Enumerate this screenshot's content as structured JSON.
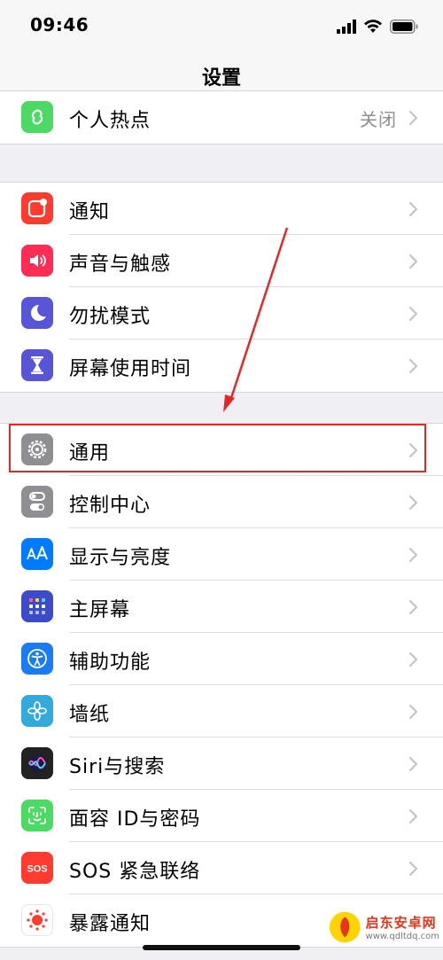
{
  "status_bar": {
    "time": "09:46"
  },
  "header": {
    "title": "设置"
  },
  "groups": [
    {
      "rows": [
        {
          "id": "hotspot",
          "label": "个人热点",
          "value": "关闭",
          "icon": "personal-hotspot-icon",
          "color": "#4cd964"
        }
      ]
    },
    {
      "rows": [
        {
          "id": "notifications",
          "label": "通知",
          "icon": "notifications-icon",
          "color": "#ff3b30"
        },
        {
          "id": "sounds",
          "label": "声音与触感",
          "icon": "speaker-icon",
          "color": "#ff2d55"
        },
        {
          "id": "dnd",
          "label": "勿扰模式",
          "icon": "moon-icon",
          "color": "#5856d6"
        },
        {
          "id": "screentime",
          "label": "屏幕使用时间",
          "icon": "hourglass-icon",
          "color": "#5856d6"
        }
      ]
    },
    {
      "rows": [
        {
          "id": "general",
          "label": "通用",
          "icon": "gear-icon",
          "color": "#8e8e93"
        },
        {
          "id": "control",
          "label": "控制中心",
          "icon": "toggle-switches-icon",
          "color": "#8e8e93"
        },
        {
          "id": "display",
          "label": "显示与亮度",
          "icon": "text-size-icon",
          "color": "#007aff"
        },
        {
          "id": "home",
          "label": "主屏幕",
          "icon": "app-grid-icon",
          "color": "#3c4cc9"
        },
        {
          "id": "accessibility",
          "label": "辅助功能",
          "icon": "accessibility-icon",
          "color": "#1a7cf5"
        },
        {
          "id": "wallpaper",
          "label": "墙纸",
          "icon": "flower-icon",
          "color": "#34aadc"
        },
        {
          "id": "siri",
          "label": "Siri与搜索",
          "icon": "siri-icon",
          "color": "#222222"
        },
        {
          "id": "faceid",
          "label": "面容 ID与密码",
          "icon": "face-id-icon",
          "color": "#4cd964"
        },
        {
          "id": "sos",
          "label": "SOS 紧急联络",
          "icon": "sos-icon",
          "color": "#ff3b30"
        },
        {
          "id": "exposure",
          "label": "暴露通知",
          "icon": "exposure-icon",
          "color": "#ffffff"
        }
      ]
    }
  ],
  "watermark": {
    "title": "启东安卓网",
    "url": "www.qdltdq.com"
  }
}
